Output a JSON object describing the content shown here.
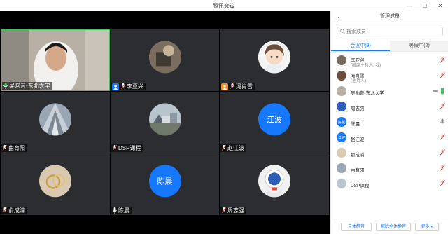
{
  "window": {
    "title": "腾讯会议"
  },
  "tiles": [
    {
      "name": "吴昫昔-东北大学",
      "mic": "on"
    },
    {
      "name": "李亚兴",
      "mic": "muted"
    },
    {
      "name": "冯肖雪",
      "mic": "muted"
    },
    {
      "name": "由育阳",
      "mic": "muted"
    },
    {
      "name": "DSP课程",
      "mic": "muted"
    },
    {
      "name": "赵江波",
      "mic": "muted",
      "avatar_text": "江波"
    },
    {
      "name": "俞成浦",
      "mic": "muted"
    },
    {
      "name": "陈晨",
      "mic": "on",
      "avatar_text": "陈晨"
    },
    {
      "name": "周志强",
      "mic": "muted"
    }
  ],
  "panel": {
    "title": "管理成员",
    "search_placeholder": "搜索成员",
    "tabs": [
      {
        "label": "会议中(9)"
      },
      {
        "label": "等候中(2)"
      }
    ],
    "members": [
      {
        "name": "李亚兴",
        "role": "(联席主持人, 我)"
      },
      {
        "name": "冯肖雪",
        "role": "(主持人)"
      },
      {
        "name": "吴昫昔-东北大学"
      },
      {
        "name": "周志强"
      },
      {
        "name": "陈晨",
        "avatar_text": "陈晨"
      },
      {
        "name": "赵江波",
        "avatar_text": "江波"
      },
      {
        "name": "俞成浦"
      },
      {
        "name": "由育阳"
      },
      {
        "name": "DSP课程"
      }
    ],
    "footer": {
      "mute_all": "全体静音",
      "unmute_all": "解除全体静音",
      "more": "更多"
    }
  },
  "colors": {
    "accent": "#1677ff",
    "active_border": "#3fc55a",
    "muted_red": "#e0463c",
    "mic_green": "#3fc55a"
  }
}
